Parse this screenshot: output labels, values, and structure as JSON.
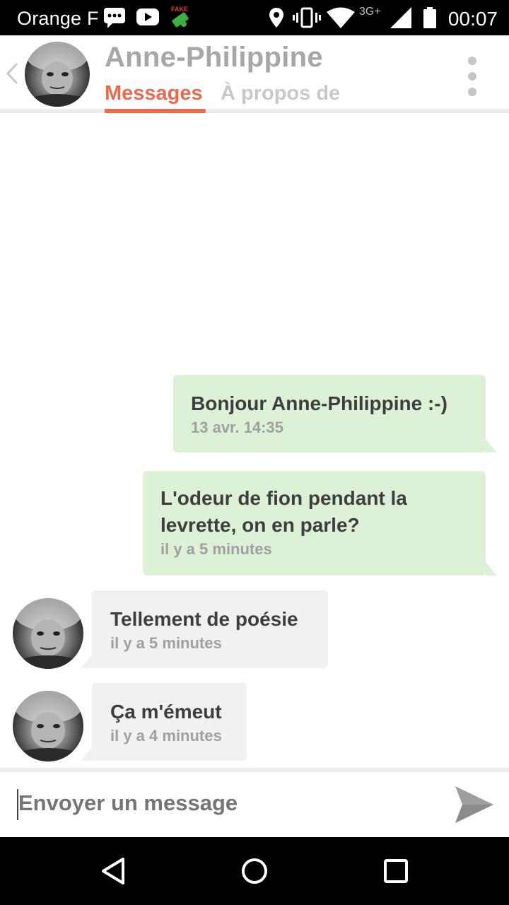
{
  "status_bar": {
    "carrier": "Orange F",
    "network": "3G+",
    "time": "00:07",
    "icons": [
      "messenger-icon",
      "youtube-icon",
      "fake-gps-icon",
      "location-icon",
      "vibrate-icon",
      "wifi-icon",
      "signal-icon",
      "battery-icon"
    ]
  },
  "header": {
    "contact_name": "Anne-Philippine",
    "tabs": [
      {
        "label": "Messages",
        "active": true
      },
      {
        "label": "À propos de",
        "active": false
      }
    ],
    "accent": "#ea6a4e"
  },
  "messages": [
    {
      "direction": "outgoing",
      "text": "Bonjour Anne-Philippine :-)",
      "time": "13 avr. 14:35"
    },
    {
      "direction": "outgoing",
      "text_lines": [
        "L'odeur de fion pendant la",
        "levrette, on en parle?"
      ],
      "time": "il y a 5 minutes"
    },
    {
      "direction": "incoming",
      "text": "Tellement de poésie",
      "time": "il y a 5 minutes"
    },
    {
      "direction": "incoming",
      "text": "Ça m'émeut",
      "time": "il y a 4 minutes"
    }
  ],
  "composer": {
    "placeholder": "Envoyer un message"
  },
  "colors": {
    "outgoing_bubble": "#dcf1d6",
    "incoming_bubble": "#f1f1f1"
  }
}
